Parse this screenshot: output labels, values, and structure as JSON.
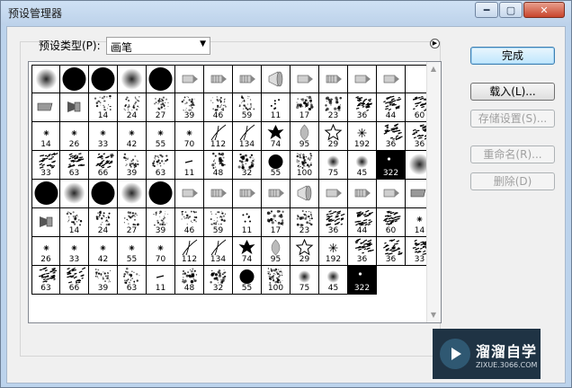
{
  "window": {
    "title": "预设管理器"
  },
  "controls": {
    "minimize": "━",
    "maximize": "▢",
    "close": "✕"
  },
  "preset_type": {
    "label": "预设类型(P):",
    "value": "画笔"
  },
  "buttons": {
    "done": "完成",
    "load": "载入(L)...",
    "save_set": "存储设置(S)...",
    "rename": "重命名(R)...",
    "delete": "删除(D)"
  },
  "watermark": {
    "name": "溜溜自学",
    "url": "ZIXUE.3066.COM"
  },
  "brushes": [
    {
      "k": "soft"
    },
    {
      "k": "hard"
    },
    {
      "k": "hard"
    },
    {
      "k": "soft"
    },
    {
      "k": "hard"
    },
    {
      "k": "tip"
    },
    {
      "k": "tip2"
    },
    {
      "k": "tip2"
    },
    {
      "k": "cone"
    },
    {
      "k": "tip"
    },
    {
      "k": "tip2"
    },
    {
      "k": "tip"
    },
    {
      "k": "tip"
    },
    {
      "k": "blank"
    },
    {
      "k": "flat"
    },
    {
      "k": "fan"
    },
    {
      "k": "scatter",
      "n": "14"
    },
    {
      "k": "scatter",
      "n": "24"
    },
    {
      "k": "scatter",
      "n": "27"
    },
    {
      "k": "scatter",
      "n": "39"
    },
    {
      "k": "scatter",
      "n": "46"
    },
    {
      "k": "scatter",
      "n": "59"
    },
    {
      "k": "dots",
      "n": "11"
    },
    {
      "k": "leaf",
      "n": "17"
    },
    {
      "k": "leaf",
      "n": "23"
    },
    {
      "k": "texture",
      "n": "36"
    },
    {
      "k": "texture",
      "n": "44"
    },
    {
      "k": "texture",
      "n": "60"
    },
    {
      "k": "star",
      "n": "14"
    },
    {
      "k": "star",
      "n": "26"
    },
    {
      "k": "star",
      "n": "33"
    },
    {
      "k": "star",
      "n": "42"
    },
    {
      "k": "star",
      "n": "55"
    },
    {
      "k": "star",
      "n": "70"
    },
    {
      "k": "grass",
      "n": "112"
    },
    {
      "k": "grass",
      "n": "134"
    },
    {
      "k": "maple",
      "n": "74"
    },
    {
      "k": "leafg",
      "n": "95"
    },
    {
      "k": "starO",
      "n": "29"
    },
    {
      "k": "spark",
      "n": "192"
    },
    {
      "k": "texture",
      "n": "36"
    },
    {
      "k": "texture",
      "n": "36"
    },
    {
      "k": "texture",
      "n": "33"
    },
    {
      "k": "texture",
      "n": "63"
    },
    {
      "k": "texture",
      "n": "66"
    },
    {
      "k": "scatter",
      "n": "39"
    },
    {
      "k": "scatter",
      "n": "63"
    },
    {
      "k": "dash",
      "n": "11"
    },
    {
      "k": "leaf",
      "n": "48"
    },
    {
      "k": "leaf",
      "n": "32"
    },
    {
      "k": "hardS",
      "n": "55"
    },
    {
      "k": "noise",
      "n": "100"
    },
    {
      "k": "softS",
      "n": "75"
    },
    {
      "k": "softS",
      "n": "45"
    },
    {
      "k": "square",
      "n": "322"
    },
    {
      "k": "soft"
    },
    {
      "k": "hard"
    },
    {
      "k": "soft"
    },
    {
      "k": "hard"
    },
    {
      "k": "soft"
    },
    {
      "k": "hard"
    },
    {
      "k": "tip"
    },
    {
      "k": "tip2"
    },
    {
      "k": "tip2"
    },
    {
      "k": "tip2"
    },
    {
      "k": "cone"
    },
    {
      "k": "tip"
    },
    {
      "k": "tip2"
    },
    {
      "k": "tip"
    },
    {
      "k": "flat"
    },
    {
      "k": "fan"
    },
    {
      "k": "scatter",
      "n": "14"
    },
    {
      "k": "scatter",
      "n": "24"
    },
    {
      "k": "scatter",
      "n": "27"
    },
    {
      "k": "scatter",
      "n": "39"
    },
    {
      "k": "scatter",
      "n": "46"
    },
    {
      "k": "scatter",
      "n": "59"
    },
    {
      "k": "dots",
      "n": "11"
    },
    {
      "k": "leaf",
      "n": "17"
    },
    {
      "k": "leaf",
      "n": "23"
    },
    {
      "k": "texture",
      "n": "36"
    },
    {
      "k": "texture",
      "n": "44"
    },
    {
      "k": "texture",
      "n": "60"
    },
    {
      "k": "star",
      "n": "14"
    },
    {
      "k": "star",
      "n": "26"
    },
    {
      "k": "star",
      "n": "33"
    },
    {
      "k": "star",
      "n": "42"
    },
    {
      "k": "star",
      "n": "55"
    },
    {
      "k": "star",
      "n": "70"
    },
    {
      "k": "grass",
      "n": "112"
    },
    {
      "k": "grass",
      "n": "134"
    },
    {
      "k": "maple",
      "n": "74"
    },
    {
      "k": "leafg",
      "n": "95"
    },
    {
      "k": "starO",
      "n": "29"
    },
    {
      "k": "spark",
      "n": "192"
    },
    {
      "k": "texture",
      "n": "36"
    },
    {
      "k": "texture",
      "n": "36"
    },
    {
      "k": "texture",
      "n": "33"
    },
    {
      "k": "texture",
      "n": "63"
    },
    {
      "k": "texture",
      "n": "66"
    },
    {
      "k": "scatter",
      "n": "39"
    },
    {
      "k": "scatter",
      "n": "63"
    },
    {
      "k": "dash",
      "n": "11"
    },
    {
      "k": "leaf",
      "n": "48"
    },
    {
      "k": "leaf",
      "n": "32"
    },
    {
      "k": "hardS",
      "n": "55"
    },
    {
      "k": "noise",
      "n": "100"
    },
    {
      "k": "softS",
      "n": "75"
    },
    {
      "k": "softS",
      "n": "45"
    },
    {
      "k": "square",
      "n": "322"
    }
  ]
}
